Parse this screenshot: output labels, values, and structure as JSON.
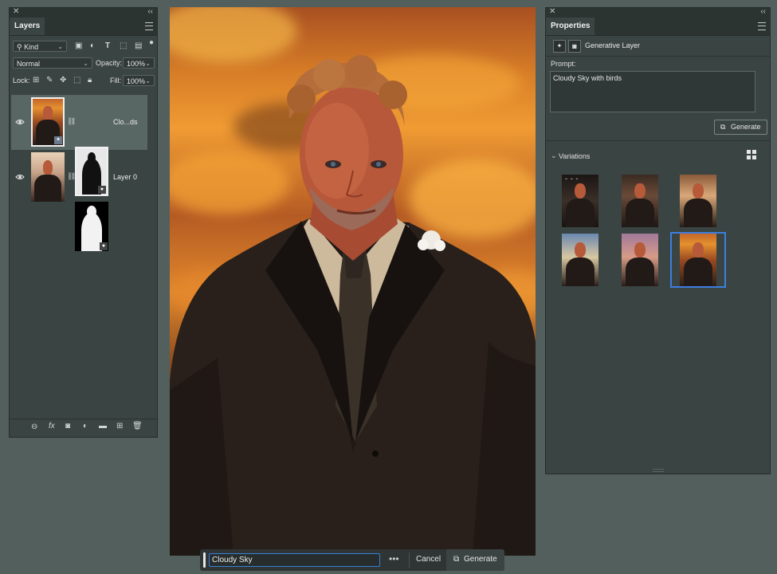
{
  "layers_panel": {
    "tab": "Layers",
    "filter_kind": "Kind",
    "blend_mode": "Normal",
    "opacity_label": "Opacity:",
    "opacity_value": "100%",
    "lock_label": "Lock:",
    "fill_label": "Fill:",
    "fill_value": "100%",
    "layers": [
      {
        "name": "Clo...ds",
        "selected": true
      },
      {
        "name": "Layer 0",
        "selected": false
      }
    ]
  },
  "properties_panel": {
    "tab": "Properties",
    "layer_type": "Generative Layer",
    "prompt_label": "Prompt:",
    "prompt_text": "Cloudy Sky with birds",
    "generate_label": "Generate",
    "variations_label": "Variations",
    "selected_variation": 6
  },
  "taskbar": {
    "prompt_value": "Cloudy Sky",
    "more_label": "•••",
    "cancel_label": "Cancel",
    "generate_label": "Generate"
  },
  "icons": {
    "panel_close": "✕",
    "panel_collapse": "‹‹",
    "link": "⛓",
    "fx": "fx"
  },
  "colors": {
    "panel_bg": "#3a4442",
    "app_bg": "#535f5d",
    "selection_blue": "#3e7ee0"
  }
}
